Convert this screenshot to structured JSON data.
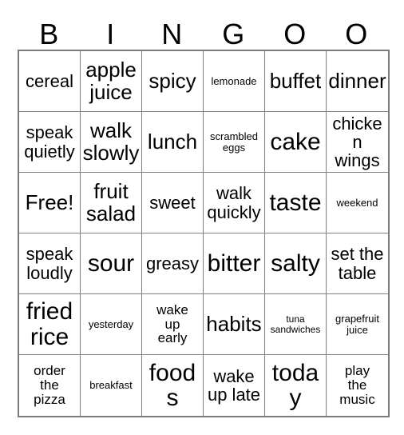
{
  "card": {
    "title": "Bingo Card",
    "columns": 6,
    "rows": 6,
    "header_letters": [
      "B",
      "I",
      "N",
      "G",
      "O",
      "O"
    ],
    "colors": {
      "background": "#ffffff",
      "text": "#000000",
      "inner_grid_line": "#808080",
      "outer_border": "#7a7a7a"
    },
    "free_space": "Free!",
    "grid": [
      [
        {
          "label": "cereal",
          "size": "md"
        },
        {
          "label": "apple\njuice",
          "size": "lg"
        },
        {
          "label": "spicy",
          "size": "lg"
        },
        {
          "label": "lemonade",
          "size": "xs"
        },
        {
          "label": "buffet",
          "size": "lg"
        },
        {
          "label": "dinner",
          "size": "lg"
        }
      ],
      [
        {
          "label": "speak\nquietly",
          "size": "md"
        },
        {
          "label": "walk\nslowly",
          "size": "lg"
        },
        {
          "label": "lunch",
          "size": "lg"
        },
        {
          "label": "scrambled\neggs",
          "size": "xs"
        },
        {
          "label": "cake",
          "size": "xl"
        },
        {
          "label": "chicken\nwings",
          "size": "md"
        }
      ],
      [
        {
          "label": "Free!",
          "size": "lg"
        },
        {
          "label": "fruit\nsalad",
          "size": "lg"
        },
        {
          "label": "sweet",
          "size": "md"
        },
        {
          "label": "walk\nquickly",
          "size": "md"
        },
        {
          "label": "taste",
          "size": "xl"
        },
        {
          "label": "weekend",
          "size": "xs"
        }
      ],
      [
        {
          "label": "speak\nloudly",
          "size": "md"
        },
        {
          "label": "sour",
          "size": "xl"
        },
        {
          "label": "greasy",
          "size": "md"
        },
        {
          "label": "bitter",
          "size": "xl"
        },
        {
          "label": "salty",
          "size": "xl"
        },
        {
          "label": "set the\ntable",
          "size": "md"
        }
      ],
      [
        {
          "label": "fried\nrice",
          "size": "xl"
        },
        {
          "label": "yesterday",
          "size": "xs"
        },
        {
          "label": "wake\nup\nearly",
          "size": "sm"
        },
        {
          "label": "habits",
          "size": "lg"
        },
        {
          "label": "tuna\nsandwiches",
          "size": "xxs"
        },
        {
          "label": "grapefruit\njuice",
          "size": "xs"
        }
      ],
      [
        {
          "label": "order\nthe\npizza",
          "size": "sm"
        },
        {
          "label": "breakfast",
          "size": "xs"
        },
        {
          "label": "foods",
          "size": "xl"
        },
        {
          "label": "wake\nup late",
          "size": "md"
        },
        {
          "label": "today",
          "size": "xl"
        },
        {
          "label": "play\nthe\nmusic",
          "size": "sm"
        }
      ]
    ]
  }
}
